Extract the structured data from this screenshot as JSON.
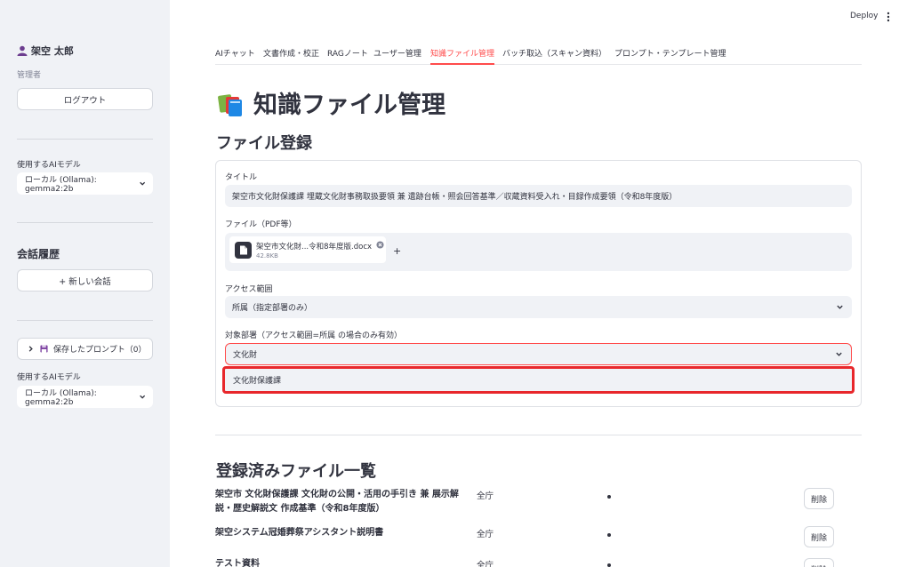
{
  "sidebar": {
    "user_name": "架空 太郎",
    "role": "管理者",
    "logout_label": "ログアウト",
    "model_label": "使用するAIモデル",
    "model_value": "ローカル (Ollama): gemma2:2b",
    "history_heading": "会話履歴",
    "new_chat_label": "+ 新しい会話",
    "saved_prompts_label": "保存したプロンプト（0）",
    "model_label_2": "使用するAIモデル",
    "model_value_2": "ローカル (Ollama): gemma2:2b"
  },
  "topbar": {
    "deploy_label": "Deploy"
  },
  "tabs": [
    {
      "label": "AIチャット"
    },
    {
      "label": "文書作成・校正"
    },
    {
      "label": "RAGノート"
    },
    {
      "label": "ユーザー管理"
    },
    {
      "label": "知識ファイル管理"
    },
    {
      "label": "バッチ取込（スキャン資料）"
    },
    {
      "label": "プロンプト・テンプレート管理"
    }
  ],
  "active_tab": "知識ファイル管理",
  "page": {
    "title": "知識ファイル管理",
    "register_heading": "ファイル登録",
    "list_heading": "登録済みファイル一覧"
  },
  "form": {
    "title_label": "タイトル",
    "title_value": "架空市文化財保護課 埋蔵文化財事務取扱要領 兼 遺跡台帳・照会回答基準／収蔵資料受入れ・目録作成要領（令和8年度版）",
    "file_label": "ファイル（PDF等）",
    "file_name": "架空市文化財...令和8年度版.docx",
    "file_size": "42.8KB",
    "add_symbol": "+",
    "access_label": "アクセス範囲",
    "access_value": "所属（指定部署のみ）",
    "dept_label": "対象部署（アクセス範囲=所属 の場合のみ有効）",
    "dept_value": "文化財",
    "dept_option": "文化財保護課"
  },
  "files": [
    {
      "title": "架空市 文化財保護課 文化財の公開・活用の手引き 兼 展示解説・歴史解説文 作成基準（令和8年度版）",
      "scope": "全庁",
      "delete_label": "削除"
    },
    {
      "title": "架空システム冠婚葬祭アシスタント説明書",
      "scope": "全庁",
      "delete_label": "削除"
    },
    {
      "title": "テスト資料",
      "scope": "全庁",
      "delete_label": "削除"
    }
  ],
  "colors": {
    "accent": "#ff4b4b",
    "sidebar_bg": "#f0f2f6",
    "text": "#31333f",
    "highlight": "#e8272b"
  }
}
